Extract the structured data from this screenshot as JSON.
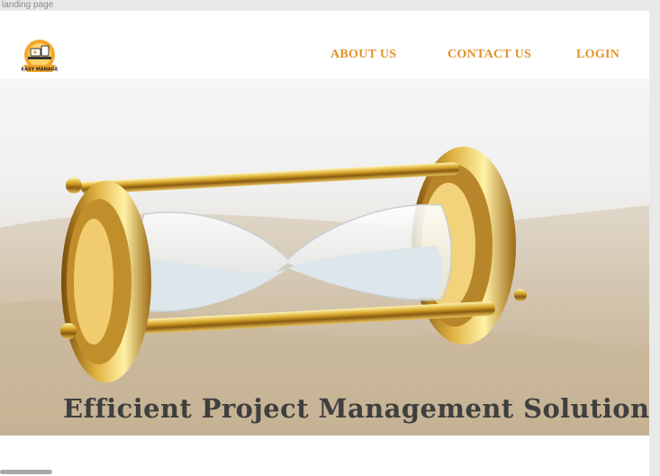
{
  "window": {
    "title": "landing page"
  },
  "brand": {
    "logo_text": "EASY MANAGE",
    "accent_color": "#e0932a"
  },
  "nav": {
    "about_label": "ABOUT US",
    "contact_label": "CONTACT US",
    "login_label": "LOGIN"
  },
  "hero": {
    "image": "hourglass-in-sand",
    "title": "Efficient Project Management Solution"
  }
}
